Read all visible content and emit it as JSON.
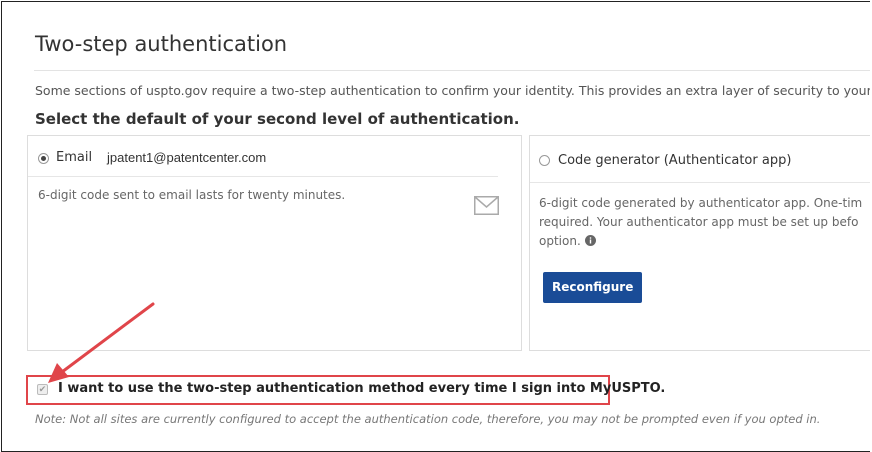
{
  "page": {
    "title": "Two-step authentication",
    "intro": "Some sections of uspto.gov require a two-step authentication to confirm your identity. This provides an extra layer of security to your a",
    "subtitle": "Select the default of your second level of authentication."
  },
  "email_option": {
    "label": "Email",
    "address": "jpatent1@patentcenter.com",
    "selected": true,
    "description": "6-digit code sent to email lasts for twenty minutes.",
    "icon": "envelope-icon"
  },
  "code_generator_option": {
    "label": "Code generator (Authenticator app)",
    "selected": false,
    "description_lines": [
      "6-digit code generated by authenticator app. One-tim",
      "required. Your authenticator app must be set up befo",
      "option."
    ],
    "info_icon": "info-circle-icon",
    "button_label": "Reconfigure"
  },
  "always_use": {
    "label": "I want to use the two-step authentication method every time I sign into MyUSPTO.",
    "checked": true
  },
  "note": "Note: Not all sites are currently configured to accept the authentication code, therefore, you may not be prompted even if you opted in.",
  "colors": {
    "button": "#1a4c97",
    "highlight": "#e0454a",
    "arrow": "#e0454a"
  }
}
